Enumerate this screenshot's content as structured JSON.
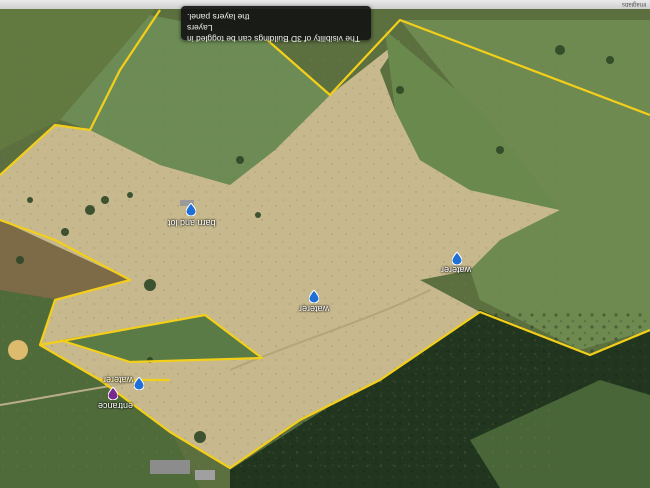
{
  "tooltip": {
    "line1": "The visibility of 3D Buildings can be toggled in",
    "line2": "the layers panel.",
    "layers_link": "Layers"
  },
  "attribution": "Imaglabs",
  "markers": [
    {
      "label": "barn and lot",
      "icon": "water-drop-icon",
      "color": "#1e6fd6"
    },
    {
      "label": "waterer",
      "icon": "water-drop-icon",
      "color": "#1e6fd6"
    },
    {
      "label": "waterer",
      "icon": "water-drop-icon",
      "color": "#1e6fd6"
    },
    {
      "label": "waterer",
      "icon": "water-drop-icon",
      "color": "#1e6fd6"
    },
    {
      "label": "entrance",
      "icon": "pin-icon",
      "color": "#7a2a8e"
    }
  ],
  "colors": {
    "boundary": "#f3cf1a",
    "dry_pasture": "#c8bb8f",
    "green_pasture": "#6f8a4e",
    "forest": "#243a22"
  }
}
